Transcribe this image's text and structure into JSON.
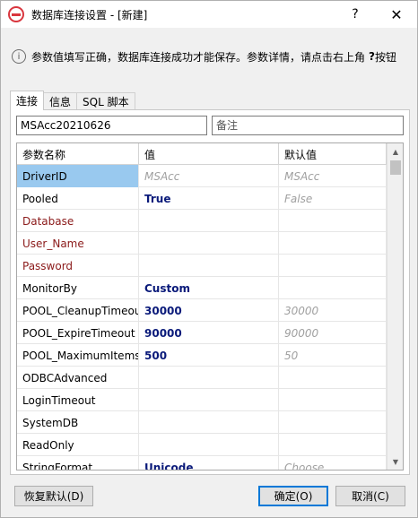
{
  "window": {
    "title": "数据库连接设置 - [新建]",
    "help_glyph": "?",
    "close_glyph": "✕"
  },
  "info": {
    "icon_glyph": "i",
    "text": "参数值填写正确，数据库连接成功才能保存。参数详情，请点击右上角",
    "help_glyph": "?",
    "help_tail": "按钮"
  },
  "tabs": [
    "连接",
    "信息",
    "SQL 脚本"
  ],
  "connection": {
    "name_value": "MSAcc20210626",
    "remark_placeholder": "备注"
  },
  "grid": {
    "headers": [
      "参数名称",
      "值",
      "默认值"
    ],
    "rows": [
      {
        "name": "DriverID",
        "value": "MSAcc",
        "default": "MSAcc"
      },
      {
        "name": "Pooled",
        "value": "True",
        "default": "False"
      },
      {
        "name": "Database",
        "value": "",
        "default": ""
      },
      {
        "name": "User_Name",
        "value": "",
        "default": ""
      },
      {
        "name": "Password",
        "value": "",
        "default": ""
      },
      {
        "name": "MonitorBy",
        "value": "Custom",
        "default": ""
      },
      {
        "name": "POOL_CleanupTimeout",
        "value": "30000",
        "default": "30000"
      },
      {
        "name": "POOL_ExpireTimeout",
        "value": "90000",
        "default": "90000"
      },
      {
        "name": "POOL_MaximumItems",
        "value": "500",
        "default": "50"
      },
      {
        "name": "ODBCAdvanced",
        "value": "",
        "default": ""
      },
      {
        "name": "LoginTimeout",
        "value": "",
        "default": ""
      },
      {
        "name": "SystemDB",
        "value": "",
        "default": ""
      },
      {
        "name": "ReadOnly",
        "value": "",
        "default": ""
      },
      {
        "name": "StringFormat",
        "value": "Unicode",
        "default": "Choose"
      }
    ],
    "scroll_up_glyph": "▲",
    "scroll_down_glyph": "▼"
  },
  "buttons": {
    "restore": "恢复默认(D)",
    "ok": "确定(O)",
    "cancel": "取消(C)"
  },
  "colors": {
    "selection": "#99c9ef",
    "required_param": "#8b1a1a",
    "value_text": "#0a1a7a",
    "default_text": "#a0a0a0",
    "ok_border": "#0078d7"
  }
}
